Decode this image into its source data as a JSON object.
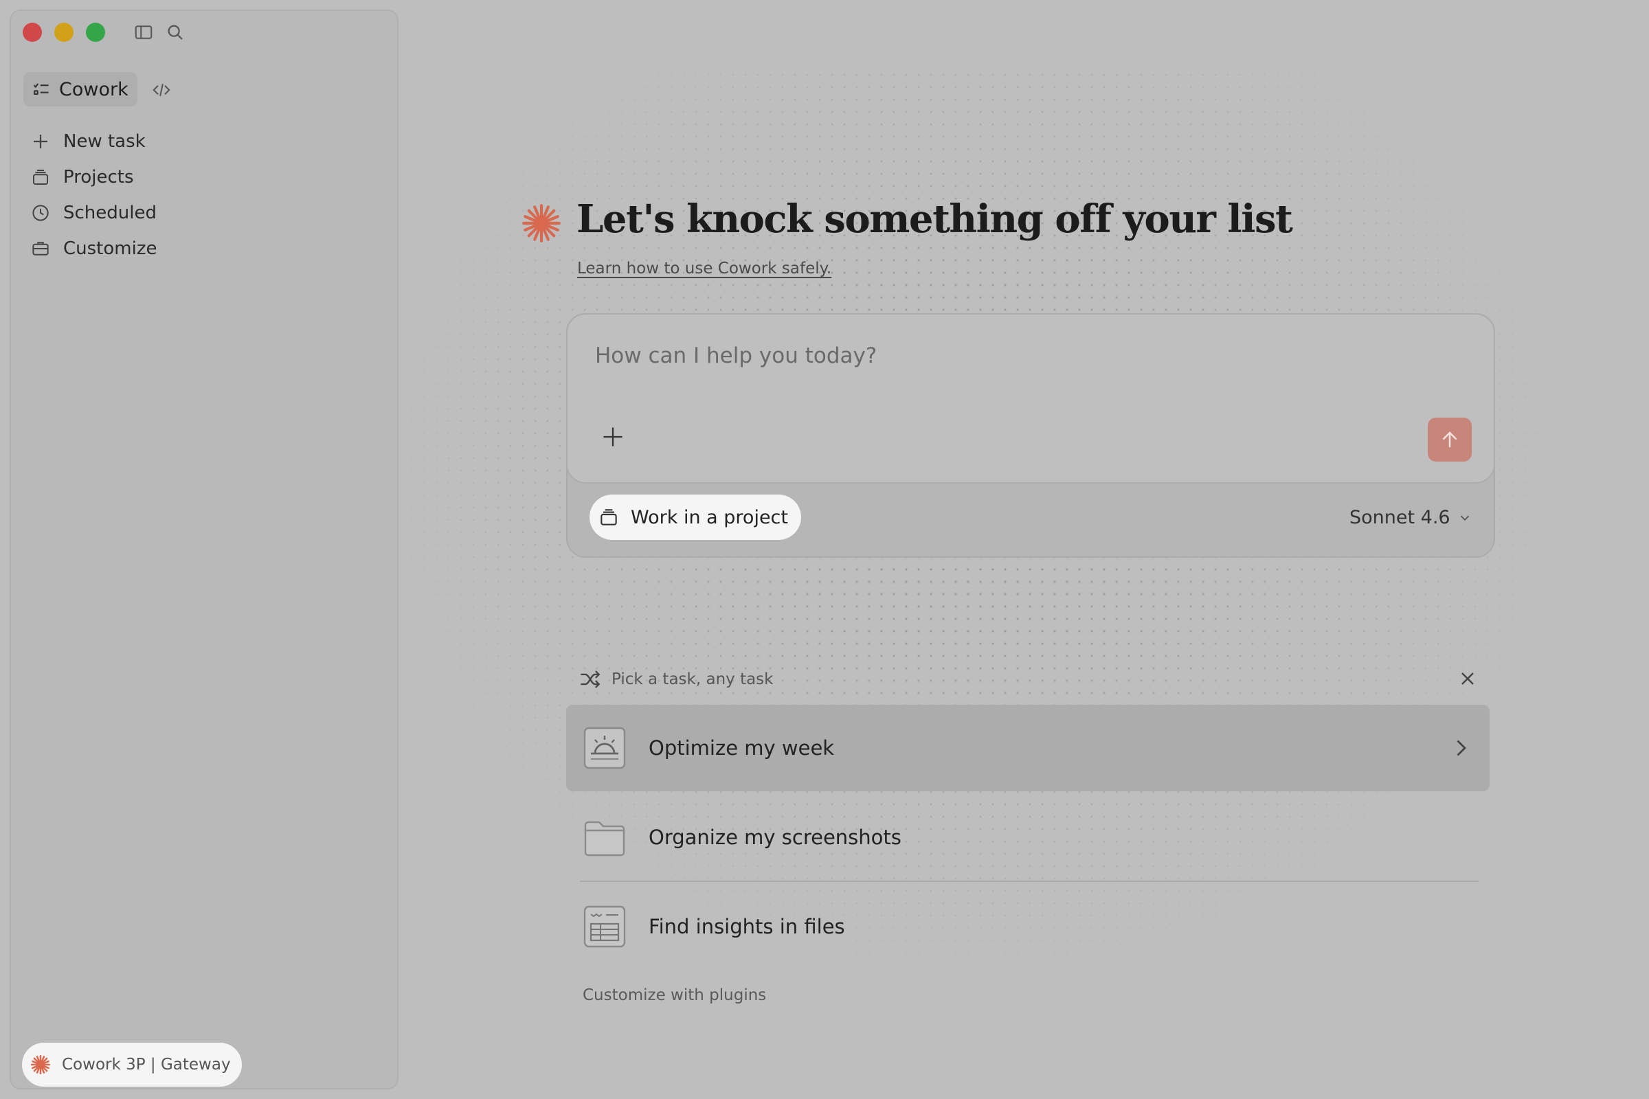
{
  "sidebar": {
    "mode_tabs": [
      {
        "label": "Cowork",
        "icon": "task-list-icon",
        "active": true
      },
      {
        "label": "",
        "icon": "code-icon",
        "active": false
      }
    ],
    "items": [
      {
        "label": "New task",
        "icon": "plus-icon"
      },
      {
        "label": "Projects",
        "icon": "projects-stack-icon"
      },
      {
        "label": "Scheduled",
        "icon": "clock-icon"
      },
      {
        "label": "Customize",
        "icon": "briefcase-icon"
      }
    ],
    "footer_label": "Cowork 3P | Gateway"
  },
  "main": {
    "headline": "Let's knock something off your list",
    "safety_link": "Learn how to use Cowork safely.",
    "composer": {
      "placeholder": "How can I help you today?",
      "project_button": "Work in a project",
      "model": "Sonnet 4.6"
    },
    "suggestions": {
      "header": "Pick a task, any task",
      "tasks": [
        {
          "label": "Optimize my week",
          "icon": "sunrise-calendar-icon",
          "active": true
        },
        {
          "label": "Organize my screenshots",
          "icon": "folder-icon",
          "active": false
        },
        {
          "label": "Find insights in files",
          "icon": "spreadsheet-icon",
          "active": false
        }
      ],
      "footer_link": "Customize with plugins"
    }
  },
  "colors": {
    "accent": "#d8694e",
    "send_button": "#c8857a",
    "background": "#bebebe",
    "traffic_red": "#d0484a",
    "traffic_yellow": "#d1a219",
    "traffic_green": "#34a649"
  }
}
